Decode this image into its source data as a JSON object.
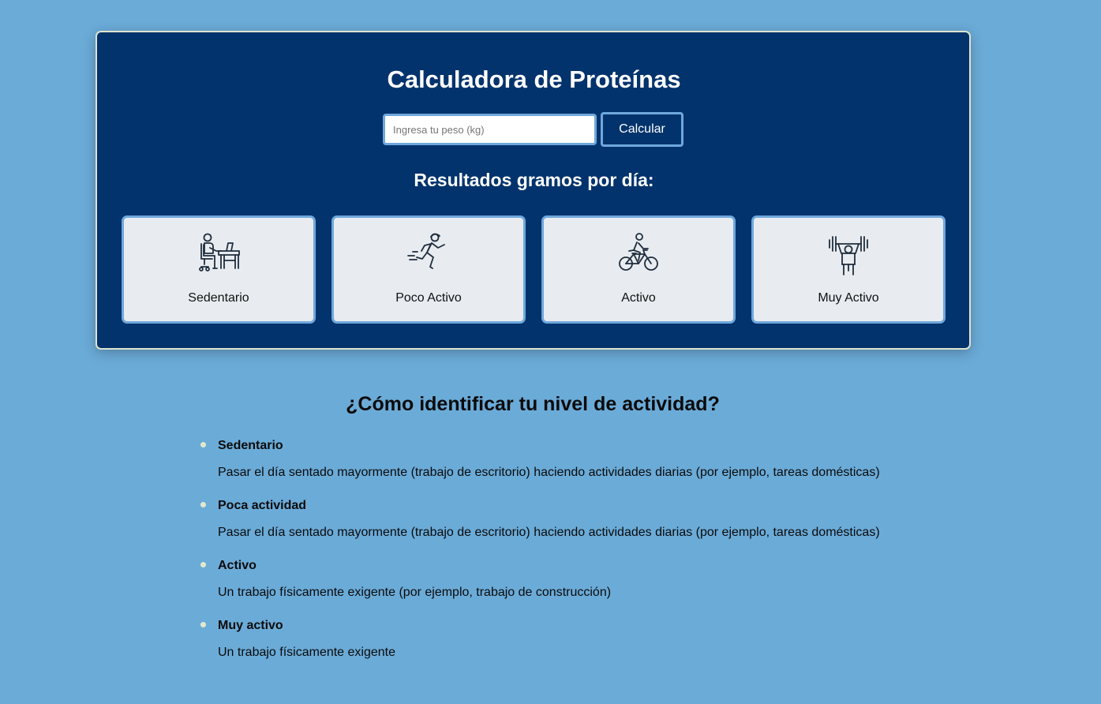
{
  "calculator": {
    "title": "Calculadora de Proteínas",
    "input_placeholder": "Ingresa tu peso (kg)",
    "input_value": "",
    "button_label": "Calcular",
    "results_title": "Resultados gramos por día:",
    "cards": [
      {
        "label": "Sedentario",
        "icon": "person-at-desk-icon"
      },
      {
        "label": "Poco Activo",
        "icon": "running-person-icon"
      },
      {
        "label": "Activo",
        "icon": "cyclist-icon"
      },
      {
        "label": "Muy Activo",
        "icon": "weightlifter-icon"
      }
    ]
  },
  "info": {
    "title": "¿Cómo identificar tu nivel de actividad?",
    "items": [
      {
        "name": "Sedentario",
        "description": "Pasar el día sentado mayormente (trabajo de escritorio) haciendo actividades diarias (por ejemplo, tareas domésticas)"
      },
      {
        "name": "Poca actividad",
        "description": "Pasar el día sentado mayormente (trabajo de escritorio) haciendo actividades diarias (por ejemplo, tareas domésticas)"
      },
      {
        "name": "Activo",
        "description": "Un trabajo físicamente exigente (por ejemplo, trabajo de construcción)"
      },
      {
        "name": "Muy activo",
        "description": "Un trabajo físicamente exigente"
      }
    ]
  },
  "colors": {
    "page_background": "#6babd8",
    "panel_background": "#02336c",
    "panel_border": "#dfe3cf",
    "accent_border": "#6fa8dc",
    "card_background": "#e8ecf0",
    "bullet": "#e3e8cd"
  }
}
